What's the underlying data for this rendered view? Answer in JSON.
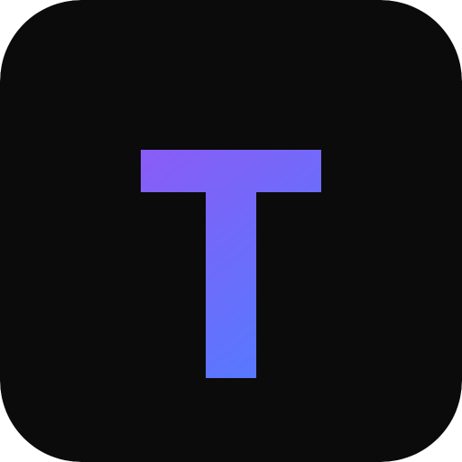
{
  "icon": {
    "name": "letter-t-app-icon",
    "letter": "T",
    "colors": {
      "background": "#0b0b0b",
      "gradient_start": "#8a5cf6",
      "gradient_end": "#4f7dff"
    }
  }
}
